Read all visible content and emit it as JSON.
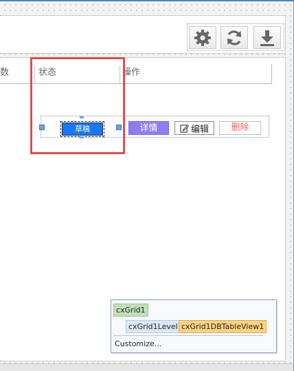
{
  "toolbar": {
    "icons": [
      "gear-icon",
      "refresh-icon",
      "download-icon"
    ]
  },
  "grid": {
    "columns": [
      {
        "label": "数"
      },
      {
        "label": "状态"
      },
      {
        "label": "操作"
      }
    ],
    "row": {
      "status_button": "草稿",
      "detail_button": "详情",
      "edit_button": "编辑",
      "delete_button": "删除"
    }
  },
  "structure_popup": {
    "root": "cxGrid1",
    "level": "cxGrid1Level1",
    "view": "cxGrid1DBTableView1",
    "customize": "Customize..."
  },
  "colors": {
    "status_button": "#1677ff",
    "detail_button": "#8f7cf2",
    "delete_text": "#e0685f",
    "highlight_box": "#e74a4a",
    "accent_border": "#4a86c8"
  }
}
